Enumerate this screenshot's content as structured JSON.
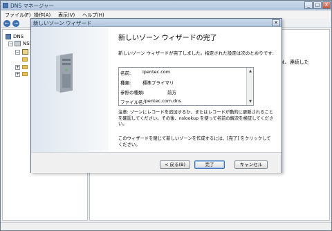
{
  "app": {
    "title": "DNS マネージャー",
    "window_buttons": {
      "minimize": "_",
      "maximize": "□",
      "close": "X"
    }
  },
  "menubar": {
    "items": [
      {
        "label": "ファイル(F)"
      },
      {
        "label": "操作(A)"
      },
      {
        "label": "表示(V)"
      },
      {
        "label": "ヘルプ(H)"
      }
    ]
  },
  "toolbar": {
    "back_glyph": "←",
    "forward_glyph": "→"
  },
  "tree": {
    "root_label": "DNS",
    "server_label": "NS1",
    "expand_glyph": "+",
    "collapse_glyph": "−"
  },
  "right_pane": {
    "snippet": "ーンは、連続した"
  },
  "wizard": {
    "title": "新しいゾーン ウィザード",
    "close_glyph": "✕",
    "heading": "新しいゾーン ウィザードの完了",
    "intro": "新しいゾーン ウィザードが完了しました。指定された設定は次のとおりです:",
    "settings": [
      {
        "label": "名前:",
        "value": "ipentec.com"
      },
      {
        "label": "種類:",
        "value": "標準プライマリ"
      },
      {
        "label": "参照の種類:",
        "value": "前方"
      },
      {
        "label": "ファイル名:",
        "value": "ipentec.com.dns"
      }
    ],
    "scroll_up": "▲",
    "scroll_down": "▼",
    "note": "注意: ゾーンにレコードを追加するか、またはレコードが動的に更新されることを確認してください。その後、nslookup を使って名前の解決を検証してください。",
    "closing": "このウィザードを閉じて新しいゾーンを作成するには、[完了] をクリックしてください。",
    "buttons": {
      "back": "< 戻る(B)",
      "finish": "完了",
      "cancel": "キャンセル"
    }
  }
}
